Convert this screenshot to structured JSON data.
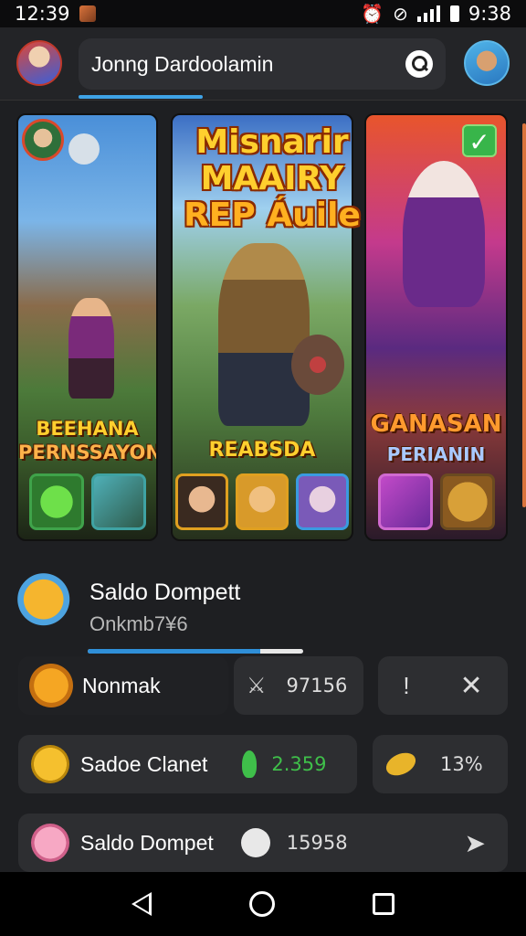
{
  "status": {
    "time": "12:39",
    "right_time": "9:38"
  },
  "search": {
    "value": "Jonng Dardoolamin"
  },
  "banner": {
    "line1": "Misnarir MAAIRY",
    "line2": "REP Áuile"
  },
  "cards": [
    {
      "title_line1": "BEEHANA",
      "title_line2": "PERNSSAYON"
    },
    {
      "title_line1": "REABSDA"
    },
    {
      "title_line1": "GANASAN",
      "title_line2": "PERIANIN"
    }
  ],
  "wallet": {
    "title": "Saldo Dompett",
    "subtitle": "Onkmb7¥6",
    "progress": 0.8
  },
  "rows": [
    {
      "label": "Nonmak",
      "value": "97156",
      "icon": "cat-face-icon",
      "value_icon": "sword-icon",
      "actions": [
        "torch-icon",
        "close-icon"
      ]
    },
    {
      "label": "Sadoe Clanet",
      "value": "2.359",
      "value_color": "#3fbf4a",
      "icon": "coin-icon",
      "value_icon": "leaf-icon",
      "extra_value": "13%",
      "extra_icon": "gold-nugget-icon"
    },
    {
      "label": "Saldo Dompet",
      "value": "15958",
      "icon": "pink-cat-icon",
      "value_icon": "ghost-icon",
      "action": "share-arrow-icon"
    }
  ],
  "colors": {
    "accent": "#3fa3e6",
    "background": "#1e1f22",
    "card_bg": "#2d2e31",
    "gold": "#ffcf2e"
  }
}
